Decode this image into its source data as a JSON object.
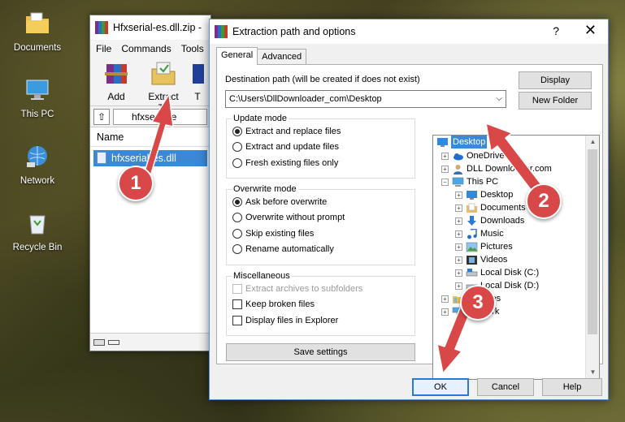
{
  "desktop": {
    "icons": [
      {
        "label": "Documents",
        "icon": "documents-folder-icon"
      },
      {
        "label": "This PC",
        "icon": "computer-icon"
      },
      {
        "label": "Network",
        "icon": "network-icon"
      },
      {
        "label": "Recycle Bin",
        "icon": "recycle-bin-icon"
      }
    ]
  },
  "winrar": {
    "title": "Hfxserial-es.dll.zip -",
    "menu": [
      "File",
      "Commands",
      "Tools"
    ],
    "toolbar": [
      {
        "label": "Add",
        "icon": "add-archive-icon"
      },
      {
        "label": "Extract To",
        "icon": "extract-to-icon"
      },
      {
        "label": "T",
        "icon": "test-icon"
      }
    ],
    "path": "hfxserial-e",
    "column_name": "Name",
    "file": "hfxserial-es.dll"
  },
  "dialog": {
    "title": "Extraction path and options",
    "help": "?",
    "close": "✕",
    "tabs": [
      "General",
      "Advanced"
    ],
    "dest_label": "Destination path (will be created if does not exist)",
    "dest_value": "C:\\Users\\DllDownloader_com\\Desktop",
    "btn_display": "Display",
    "btn_new_folder": "New Folder",
    "update_mode": {
      "legend": "Update mode",
      "options": [
        "Extract and replace files",
        "Extract and update files",
        "Fresh existing files only"
      ],
      "selected": 0
    },
    "overwrite_mode": {
      "legend": "Overwrite mode",
      "options": [
        "Ask before overwrite",
        "Overwrite without prompt",
        "Skip existing files",
        "Rename automatically"
      ],
      "selected": 0
    },
    "misc": {
      "legend": "Miscellaneous",
      "options": [
        "Extract archives to subfolders",
        "Keep broken files",
        "Display files in Explorer"
      ]
    },
    "btn_save": "Save settings",
    "tree": [
      {
        "label": "Desktop",
        "icon": "desktop-folder-icon",
        "selected": true
      },
      {
        "label": "OneDrive",
        "icon": "onedrive-icon"
      },
      {
        "label": "DLL Downloader.com",
        "icon": "user-icon"
      },
      {
        "label": "This PC",
        "icon": "computer-icon"
      },
      {
        "label": "Desktop",
        "icon": "desktop-folder-icon"
      },
      {
        "label": "Documents",
        "icon": "documents-folder-icon"
      },
      {
        "label": "Downloads",
        "icon": "downloads-folder-icon"
      },
      {
        "label": "Music",
        "icon": "music-folder-icon"
      },
      {
        "label": "Pictures",
        "icon": "pictures-folder-icon"
      },
      {
        "label": "Videos",
        "icon": "videos-folder-icon"
      },
      {
        "label": "Local Disk (C:)",
        "icon": "drive-icon"
      },
      {
        "label": "Local Disk (D:)",
        "icon": "drive-icon"
      },
      {
        "label": "Libraries",
        "icon": "libraries-icon"
      },
      {
        "label": "Network",
        "icon": "network-icon"
      }
    ],
    "btn_ok": "OK",
    "btn_cancel": "Cancel",
    "btn_help": "Help"
  },
  "annotations": [
    "1",
    "2",
    "3"
  ],
  "colors": {
    "accent": "#3a8ad9",
    "marker": "#d94848",
    "window_border": "#5b8fd6"
  }
}
